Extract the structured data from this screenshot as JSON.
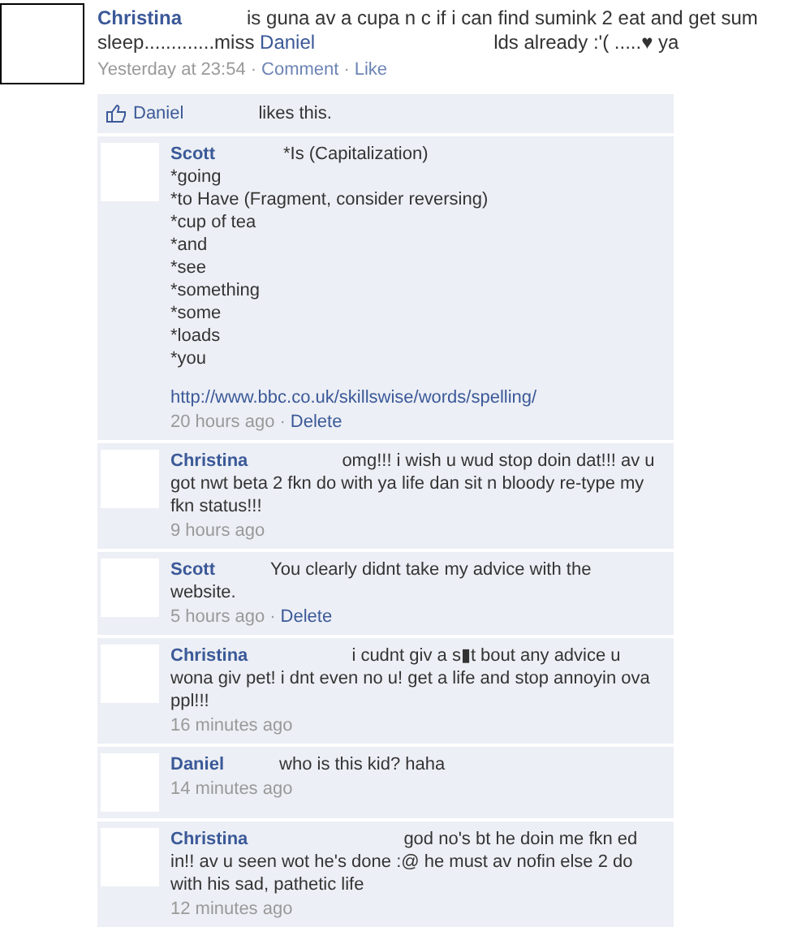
{
  "post": {
    "author": "Christina",
    "text_before": "is guna av a cupa n c if i can find sumink 2 eat and get sum sleep.............miss",
    "mention": "Daniel",
    "text_after": "lds already :'( .....♥ ya",
    "time": "Yesterday at 23:54",
    "separator": "·",
    "actions": [
      "Comment",
      "Like"
    ]
  },
  "likes": {
    "name": "Daniel",
    "text": "likes this."
  },
  "comments": [
    {
      "author": "Scott",
      "text": "*Is (Capitalization)\n*going\n*to Have (Fragment, consider reversing)\n*cup of tea\n*and\n*see\n*something\n*some\n*loads\n*you",
      "link": "http://www.bbc.co.uk/skillswise/words/spelling/",
      "time": "20 hours ago",
      "action": "Delete"
    },
    {
      "author": "Christina",
      "text": "omg!!! i wish u wud stop doin dat!!! av u got nwt beta 2 fkn do with ya life dan sit n bloody re-type my fkn status!!!",
      "time": "9 hours ago"
    },
    {
      "author": "Scott",
      "text": "You clearly didnt take my advice with the website.",
      "time": "5 hours ago",
      "action": "Delete"
    },
    {
      "author": "Christina",
      "text": "i cudnt giv a s▮t bout any advice u wona giv pet! i dnt even no u! get a life and stop annoyin ova ppl!!!",
      "time": "16 minutes ago"
    },
    {
      "author": "Daniel",
      "text": "who is this kid? haha",
      "time": "14 minutes ago"
    },
    {
      "author": "Christina",
      "text": "god no's bt he doin me fkn ed in!! av u seen wot he's done :@ he must av nofin else 2 do with his sad, pathetic life",
      "time": "12 minutes ago"
    }
  ]
}
